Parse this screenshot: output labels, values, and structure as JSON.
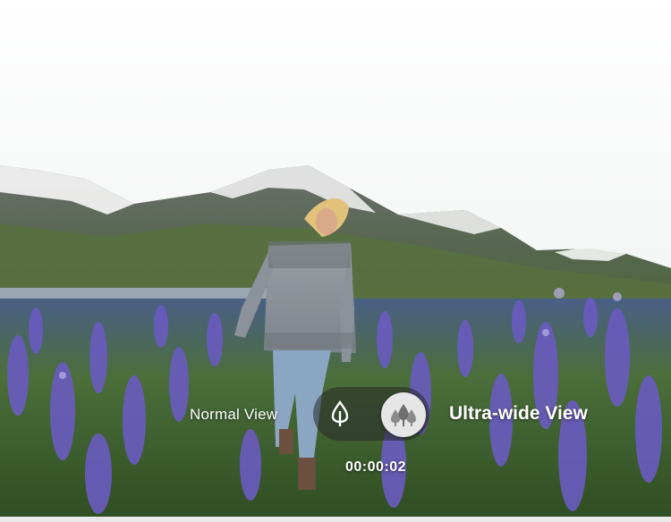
{
  "viewer": {
    "normal_label": "Normal View",
    "wide_label": "Ultra-wide View",
    "selected_mode": "Ultra-wide View",
    "timestamp": "00:00:02"
  },
  "icons": {
    "normal": "single-tree-icon",
    "wide": "multiple-trees-icon"
  },
  "colors": {
    "sky": "#f4f4f4",
    "mountain": "#5f6f5c",
    "snow": "#ffffff",
    "lupine": "#6a5bb8",
    "grass": "#3f6a2e",
    "toggle_active": "#e6e6e6"
  }
}
